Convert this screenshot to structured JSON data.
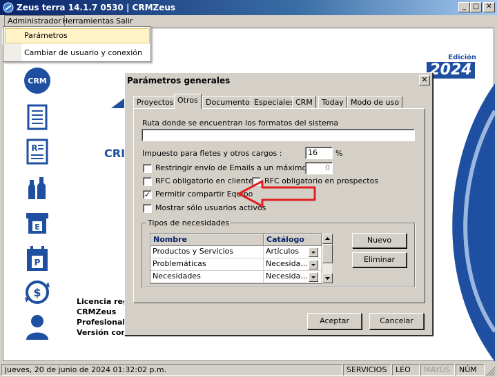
{
  "window": {
    "title": "Zeus terra 14.1.7 0530 | CRMZeus",
    "minimize": "_",
    "maximize": "□",
    "close": "✕"
  },
  "menu": {
    "items": [
      "Administrador",
      "Herramientas",
      "Salir"
    ],
    "dropdown": [
      "Parámetros",
      "Cambiar de usuario y conexión"
    ]
  },
  "brand": {
    "edition_label": "Edición",
    "edition_year": "2024",
    "partial_text": "CRI"
  },
  "info": {
    "line1": "Licencia regi",
    "line2": "CRMZeus",
    "line3": "Profesional",
    "line4": "Versión com"
  },
  "sidebar": {
    "crm_label": "CRM",
    "e_label": "E",
    "p_label": "P"
  },
  "dialog": {
    "title": "Parámetros generales",
    "close": "✕",
    "tabs": [
      "Proyectos",
      "Otros",
      "Documentos",
      "Especiales",
      "CRM",
      "Today",
      "Modo de uso"
    ],
    "ruta_label": "Ruta donde se encuentran los formatos del sistema",
    "ruta_value": "",
    "impuesto_label": "Impuesto para fletes y otros cargos :",
    "impuesto_value": "16",
    "impuesto_unit": "%",
    "restringir_label": "Restringir envío de Emails a un máximo de:",
    "restringir_value": "0",
    "rfc_clientes_label": "RFC obligatorio en clientes",
    "rfc_prospectos_label": "RFC obligatorio en prospectos",
    "compartir_label": "Permitir compartir Equipo",
    "compartir_check": "✓",
    "activos_label": "Mostrar sólo usuarios activos",
    "necesidades_title": "Tipos de necesidades",
    "grid": {
      "col_nombre": "Nombre",
      "col_catalogo": "Catálogo",
      "rows": [
        {
          "nombre": "Productos y Servicios",
          "catalogo": "Artículos"
        },
        {
          "nombre": "Problemáticas",
          "catalogo": "Necesida..."
        },
        {
          "nombre": "Necesidades",
          "catalogo": "Necesida..."
        }
      ]
    },
    "nuevo_button": "Nuevo",
    "eliminar_button": "Eliminar",
    "aceptar_button": "Aceptar",
    "cancelar_button": "Cancelar"
  },
  "status": {
    "datetime": "jueves, 20 de junio de 2024 01:32:02 p.m.",
    "servicios": "SERVICIOS",
    "user": "LEO",
    "mayus": "MAYÚS",
    "num": "NÚM"
  },
  "colors": {
    "brand_blue": "#1e4fa0",
    "annotation_red": "#e02020",
    "menu_highlight": "#fff3c8"
  }
}
